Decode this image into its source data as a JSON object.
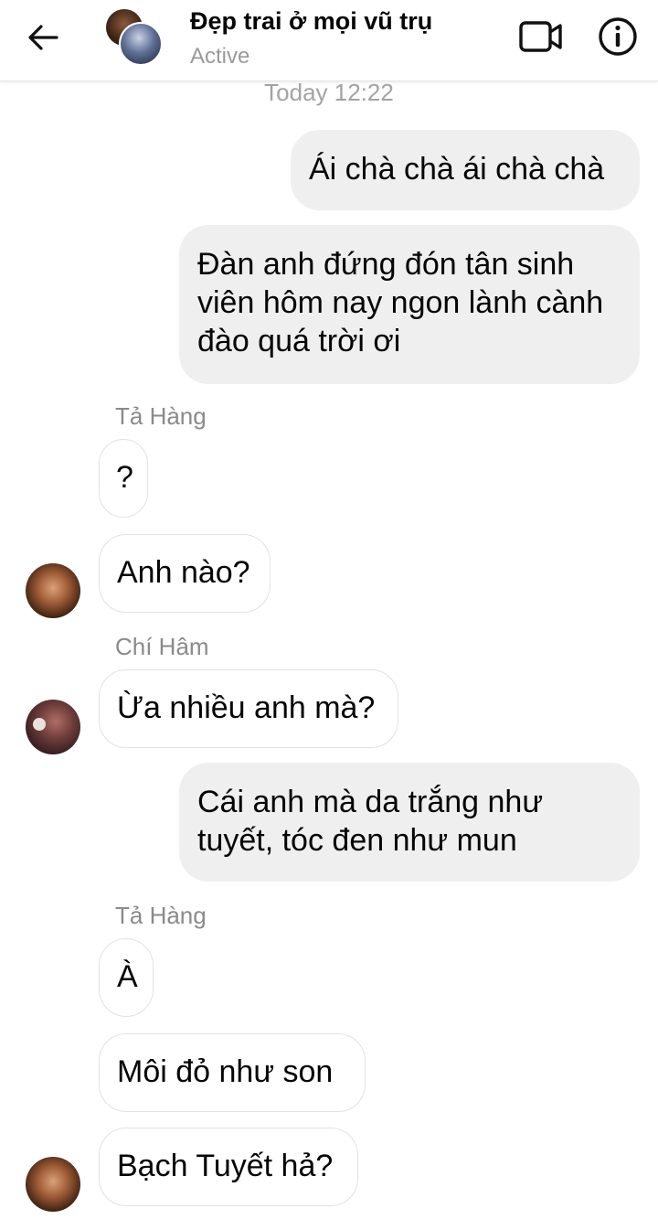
{
  "header": {
    "title": "Đẹp trai ở mọi vũ trụ",
    "status": "Active",
    "icons": {
      "back": "arrow-left-icon",
      "video": "video-camera-icon",
      "info": "info-icon"
    }
  },
  "timestamp": "Today 12:22",
  "messages": {
    "m1": "Ái chà chà ái chà chà",
    "m2": "Đàn anh đứng đón tân sinh viên hôm nay ngon lành cành đào quá trời ơi",
    "s1": "Tả Hàng",
    "m3": "?",
    "m4": "Anh nào?",
    "s2": "Chí Hâm",
    "m5": "Ừa nhiều anh mà?",
    "m6": "Cái anh mà da trắng như tuyết, tóc đen như mun",
    "s3": "Tả Hàng",
    "m7": "À",
    "m8": "Môi đỏ như son",
    "m9": "Bạch Tuyết hả?"
  },
  "colors": {
    "outgoing_bubble": "#efefef",
    "incoming_border": "#e2e2e2",
    "secondary_text": "#8a8a8a"
  }
}
